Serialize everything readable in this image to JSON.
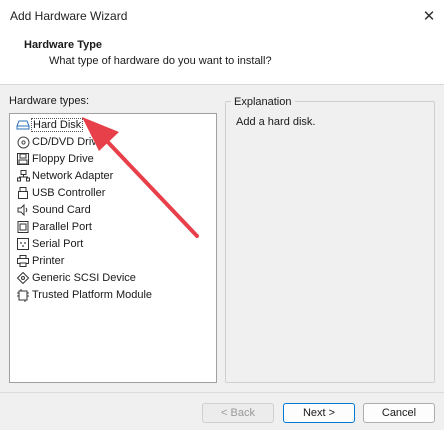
{
  "window": {
    "title": "Add Hardware Wizard",
    "close_glyph": "✕"
  },
  "header": {
    "title": "Hardware Type",
    "subtitle": "What type of hardware do you want to install?"
  },
  "hardware_list": {
    "label": "Hardware types:",
    "selected": "Hard Disk",
    "items": [
      {
        "label": "Hard Disk",
        "icon": "hard-disk-icon"
      },
      {
        "label": "CD/DVD Drive",
        "icon": "cd-dvd-icon"
      },
      {
        "label": "Floppy Drive",
        "icon": "floppy-icon"
      },
      {
        "label": "Network Adapter",
        "icon": "network-adapter-icon"
      },
      {
        "label": "USB Controller",
        "icon": "usb-icon"
      },
      {
        "label": "Sound Card",
        "icon": "sound-card-icon"
      },
      {
        "label": "Parallel Port",
        "icon": "parallel-port-icon"
      },
      {
        "label": "Serial Port",
        "icon": "serial-port-icon"
      },
      {
        "label": "Printer",
        "icon": "printer-icon"
      },
      {
        "label": "Generic SCSI Device",
        "icon": "scsi-icon"
      },
      {
        "label": "Trusted Platform Module",
        "icon": "tpm-icon"
      }
    ]
  },
  "explanation": {
    "label": "Explanation",
    "text": "Add a hard disk."
  },
  "buttons": {
    "back": "< Back",
    "next": "Next >",
    "cancel": "Cancel"
  },
  "annotation": {
    "arrow_color": "#e8404a"
  }
}
